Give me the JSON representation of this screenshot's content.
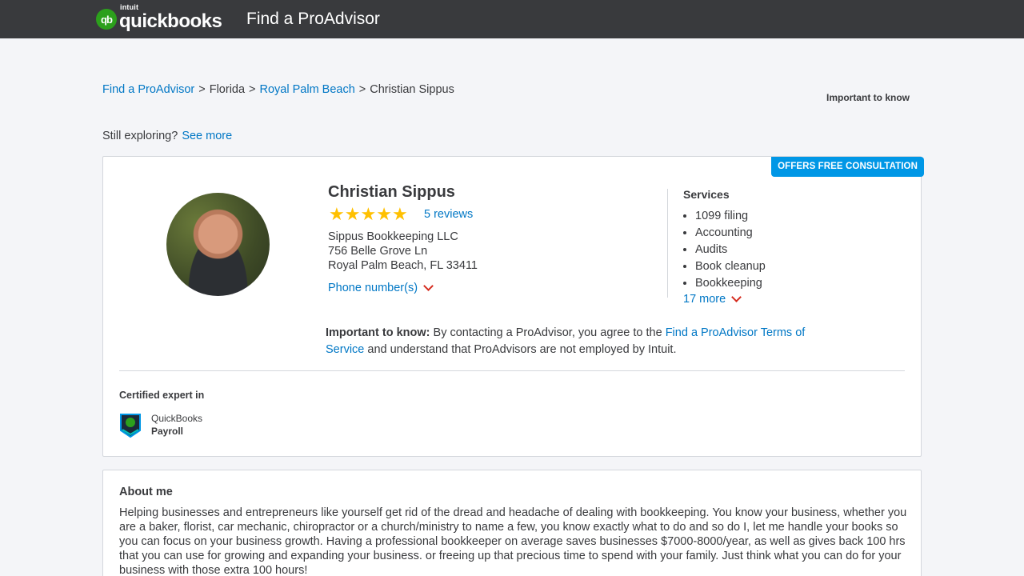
{
  "header": {
    "logo_intuit": "intuit",
    "logo_brand": "quickbooks",
    "logo_mark": "qb",
    "title": "Find a ProAdvisor"
  },
  "breadcrumb": {
    "items": [
      "Find a ProAdvisor",
      "Florida",
      "Royal Palm Beach",
      "Christian Sippus"
    ],
    "separator": ">"
  },
  "important_link": "Important to know",
  "exploring": {
    "text": "Still exploring?",
    "link": "See more"
  },
  "profile": {
    "badge": "OFFERS FREE CONSULTATION",
    "name": "Christian Sippus",
    "rating": 5,
    "reviews": "5 reviews",
    "company": "Sippus Bookkeeping LLC",
    "address_line1": "756 Belle Grove Ln",
    "address_line2": "Royal Palm Beach, FL 33411",
    "phone_label": "Phone number(s)",
    "services_title": "Services",
    "services": [
      "1099 filing",
      "Accounting",
      "Audits",
      "Book cleanup",
      "Bookkeeping"
    ],
    "services_more": "17 more",
    "notice": {
      "label": "Important to know:",
      "text_before": " By contacting a ProAdvisor, you agree to the ",
      "link": "Find a ProAdvisor Terms of Service",
      "text_after": " and understand that ProAdvisors are not employed by Intuit."
    },
    "certified_title": "Certified expert in",
    "certification": {
      "line1": "QuickBooks",
      "line2": "Payroll"
    }
  },
  "about": {
    "title": "About me",
    "text": "Helping businesses and entrepreneurs like yourself get rid of the dread and headache of dealing with bookkeeping. You know your business, whether you are a baker, florist, car mechanic, chiropractor or a church/ministry to name a few, you know exactly what to do and so do I, let me handle your books so you can focus on your business growth. Having a professional bookkeeper on average saves businesses $7000-8000/year, as well as gives back 100 hrs that you can use for growing and expanding your business. or freeing up that precious time to spend with your family. Just think what you can do for your business with those extra 100 hours!"
  },
  "colors": {
    "header_bg": "#393a3d",
    "link": "#0077c5",
    "brand_green": "#2ca01c",
    "star": "#ffc000",
    "badge": "#0097e6",
    "chevron": "#d52b1e"
  }
}
